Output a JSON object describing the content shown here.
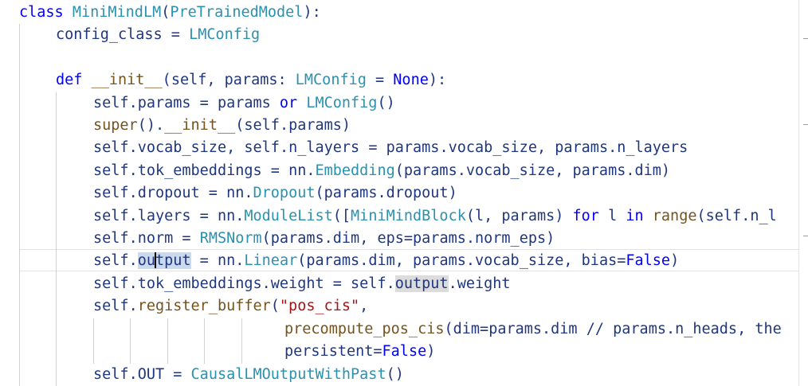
{
  "editor": {
    "lines": [
      "class MiniMindLM(PreTrainedModel):",
      "config_class = LMConfig",
      "def __init__(self, params: LMConfig = None):",
      "self.params = params or LMConfig()",
      "super().__init__(self.params)",
      "self.vocab_size, self.n_layers = params.vocab_size, params.n_layers",
      "self.tok_embeddings = nn.Embedding(params.vocab_size, params.dim)",
      "self.dropout = nn.Dropout(params.dropout)",
      "self.layers = nn.ModuleList([MiniMindBlock(l, params) for l in range(self.n_l",
      "self.norm = RMSNorm(params.dim, eps=params.norm_eps)",
      "self.output = nn.Linear(params.dim, params.vocab_size, bias=False)",
      "self.tok_embeddings.weight = self.output.weight",
      "self.register_buffer(\"pos_cis\",",
      "precompute_pos_cis(dim=params.dim // params.n_heads, the",
      "persistent=False)",
      "self.OUT = CausalLMOutputWithPast()"
    ],
    "colors": {
      "keyword": "#0000ff",
      "class": "#2b91af",
      "function": "#74531f",
      "identifier": "#1f377f",
      "string": "#a31515",
      "selection": "#c9d9ee",
      "reference_highlight": "#dcdcdc"
    }
  }
}
